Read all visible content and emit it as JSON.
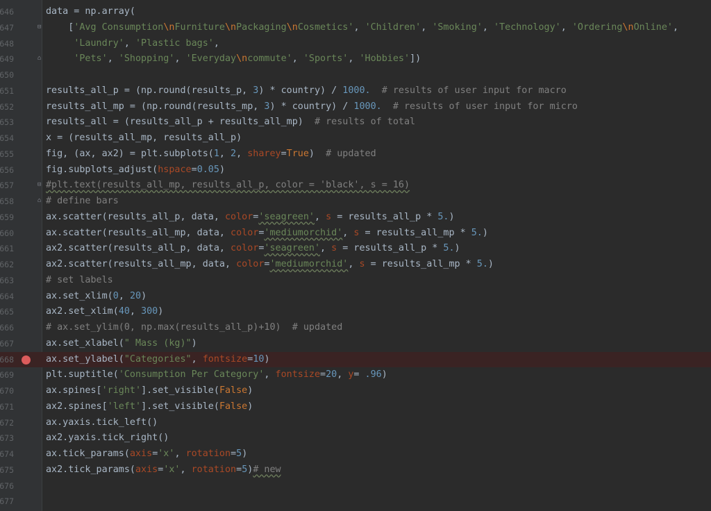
{
  "editor": {
    "lines": [
      {
        "num": "646",
        "fold": "",
        "bp": false,
        "tokens": [
          [
            "data = np.array(",
            "p"
          ]
        ]
      },
      {
        "num": "647",
        "fold": "−",
        "bp": false,
        "tokens": [
          [
            "    [",
            "p"
          ],
          [
            "'Avg Consumption",
            "str"
          ],
          [
            "\\n",
            "esc"
          ],
          [
            "Furniture",
            "str"
          ],
          [
            "\\n",
            "esc"
          ],
          [
            "Packaging",
            "str"
          ],
          [
            "\\n",
            "esc"
          ],
          [
            "Cosmetics'",
            "str"
          ],
          [
            ", ",
            "p"
          ],
          [
            "'Children'",
            "str"
          ],
          [
            ", ",
            "p"
          ],
          [
            "'Smoking'",
            "str"
          ],
          [
            ", ",
            "p"
          ],
          [
            "'Technology'",
            "str"
          ],
          [
            ", ",
            "p"
          ],
          [
            "'Ordering",
            "str"
          ],
          [
            "\\n",
            "esc"
          ],
          [
            "Online'",
            "str"
          ],
          [
            ",",
            "p"
          ]
        ]
      },
      {
        "num": "648",
        "fold": "",
        "bp": false,
        "tokens": [
          [
            "     ",
            "p"
          ],
          [
            "'Laundry'",
            "str"
          ],
          [
            ", ",
            "p"
          ],
          [
            "'Plastic bags'",
            "str"
          ],
          [
            ",",
            "p"
          ]
        ]
      },
      {
        "num": "649",
        "fold": "△",
        "bp": false,
        "tokens": [
          [
            "     ",
            "p"
          ],
          [
            "'Pets'",
            "str"
          ],
          [
            ", ",
            "p"
          ],
          [
            "'Shopping'",
            "str"
          ],
          [
            ", ",
            "p"
          ],
          [
            "'Everyday",
            "str"
          ],
          [
            "\\n",
            "esc"
          ],
          [
            "commute'",
            "str"
          ],
          [
            ", ",
            "p"
          ],
          [
            "'Sports'",
            "str"
          ],
          [
            ", ",
            "p"
          ],
          [
            "'Hobbies'",
            "str"
          ],
          [
            "])",
            "p"
          ]
        ]
      },
      {
        "num": "650",
        "fold": "",
        "bp": false,
        "tokens": []
      },
      {
        "num": "651",
        "fold": "",
        "bp": false,
        "tokens": [
          [
            "results_all_p = (np.round(results_p, ",
            "p"
          ],
          [
            "3",
            "num"
          ],
          [
            ") * country) / ",
            "p"
          ],
          [
            "1000.",
            "num"
          ],
          [
            "  ",
            "p"
          ],
          [
            "# results of user input for macro",
            "cm"
          ]
        ]
      },
      {
        "num": "652",
        "fold": "",
        "bp": false,
        "tokens": [
          [
            "results_all_mp = (np.round(results_mp, ",
            "p"
          ],
          [
            "3",
            "num"
          ],
          [
            ") * country) / ",
            "p"
          ],
          [
            "1000.",
            "num"
          ],
          [
            "  ",
            "p"
          ],
          [
            "# results of user input for micro",
            "cm"
          ]
        ]
      },
      {
        "num": "653",
        "fold": "",
        "bp": false,
        "tokens": [
          [
            "results_all = (results_all_p + results_all_mp)  ",
            "p"
          ],
          [
            "# results of total",
            "cm"
          ]
        ]
      },
      {
        "num": "654",
        "fold": "",
        "bp": false,
        "tokens": [
          [
            "x = (results_all_mp, results_all_p)",
            "p"
          ]
        ]
      },
      {
        "num": "655",
        "fold": "",
        "bp": false,
        "tokens": [
          [
            "fig, (ax, ax2) = plt.subplots(",
            "p"
          ],
          [
            "1",
            "num"
          ],
          [
            ", ",
            "p"
          ],
          [
            "2",
            "num"
          ],
          [
            ", ",
            "p"
          ],
          [
            "sharey",
            "kwarg"
          ],
          [
            "=",
            "p"
          ],
          [
            "True",
            "kw"
          ],
          [
            ")  ",
            "p"
          ],
          [
            "# updated",
            "cm"
          ]
        ]
      },
      {
        "num": "656",
        "fold": "",
        "bp": false,
        "tokens": [
          [
            "fig.subplots_adjust(",
            "p"
          ],
          [
            "hspace",
            "kwarg"
          ],
          [
            "=",
            "p"
          ],
          [
            "0.05",
            "num"
          ],
          [
            ")",
            "p"
          ]
        ]
      },
      {
        "num": "657",
        "fold": "−",
        "bp": false,
        "tokens": [
          [
            "#plt.text(results_all_mp, results_all_p, color = 'black', s = 16)",
            "cm wavy"
          ]
        ]
      },
      {
        "num": "658",
        "fold": "△",
        "bp": false,
        "tokens": [
          [
            "# define bars",
            "cm"
          ]
        ]
      },
      {
        "num": "659",
        "fold": "",
        "bp": false,
        "tokens": [
          [
            "ax.scatter(results_all_p, data, ",
            "p"
          ],
          [
            "color",
            "kwarg"
          ],
          [
            "=",
            "p"
          ],
          [
            "'seagreen'",
            "str wavy"
          ],
          [
            ", ",
            "p"
          ],
          [
            "s",
            "kwarg"
          ],
          [
            " = results_all_p * ",
            "p"
          ],
          [
            "5.",
            "num"
          ],
          [
            ")",
            "p"
          ]
        ]
      },
      {
        "num": "660",
        "fold": "",
        "bp": false,
        "tokens": [
          [
            "ax.scatter(results_all_mp, data, ",
            "p"
          ],
          [
            "color",
            "kwarg"
          ],
          [
            "=",
            "p"
          ],
          [
            "'mediumorchid'",
            "str wavy"
          ],
          [
            ", ",
            "p"
          ],
          [
            "s",
            "kwarg"
          ],
          [
            " = results_all_mp * ",
            "p"
          ],
          [
            "5.",
            "num"
          ],
          [
            ")",
            "p"
          ]
        ]
      },
      {
        "num": "661",
        "fold": "",
        "bp": false,
        "tokens": [
          [
            "ax2.scatter(results_all_p, data, ",
            "p"
          ],
          [
            "color",
            "kwarg"
          ],
          [
            "=",
            "p"
          ],
          [
            "'seagreen'",
            "str wavy"
          ],
          [
            ", ",
            "p"
          ],
          [
            "s",
            "kwarg"
          ],
          [
            " = results_all_p * ",
            "p"
          ],
          [
            "5.",
            "num"
          ],
          [
            ")",
            "p"
          ]
        ]
      },
      {
        "num": "662",
        "fold": "",
        "bp": false,
        "tokens": [
          [
            "ax2.scatter(results_all_mp, data, ",
            "p"
          ],
          [
            "color",
            "kwarg"
          ],
          [
            "=",
            "p"
          ],
          [
            "'mediumorchid'",
            "str wavy"
          ],
          [
            ", ",
            "p"
          ],
          [
            "s",
            "kwarg"
          ],
          [
            " = results_all_mp * ",
            "p"
          ],
          [
            "5.",
            "num"
          ],
          [
            ")",
            "p"
          ]
        ]
      },
      {
        "num": "663",
        "fold": "",
        "bp": false,
        "tokens": [
          [
            "# set labels",
            "cm"
          ]
        ]
      },
      {
        "num": "664",
        "fold": "",
        "bp": false,
        "tokens": [
          [
            "ax.set_xlim(",
            "p"
          ],
          [
            "0",
            "num"
          ],
          [
            ", ",
            "p"
          ],
          [
            "20",
            "num"
          ],
          [
            ")",
            "p"
          ]
        ]
      },
      {
        "num": "665",
        "fold": "",
        "bp": false,
        "tokens": [
          [
            "ax2.set_xlim(",
            "p"
          ],
          [
            "40",
            "num"
          ],
          [
            ", ",
            "p"
          ],
          [
            "300",
            "num"
          ],
          [
            ")",
            "p"
          ]
        ]
      },
      {
        "num": "666",
        "fold": "",
        "bp": false,
        "tokens": [
          [
            "# ax.set_ylim(0, np.max(results_all_p)+10)  # updated",
            "cm"
          ]
        ]
      },
      {
        "num": "667",
        "fold": "",
        "bp": false,
        "tokens": [
          [
            "ax.set_xlabel(",
            "p"
          ],
          [
            "\" Mass (kg)\"",
            "str"
          ],
          [
            ")",
            "p"
          ]
        ]
      },
      {
        "num": "668",
        "fold": "",
        "bp": true,
        "tokens": [
          [
            "ax.set_ylabel(",
            "p"
          ],
          [
            "\"Categories\"",
            "str"
          ],
          [
            ", ",
            "p"
          ],
          [
            "fontsize",
            "kwarg"
          ],
          [
            "=",
            "p"
          ],
          [
            "10",
            "num"
          ],
          [
            ")",
            "p"
          ]
        ]
      },
      {
        "num": "669",
        "fold": "",
        "bp": false,
        "tokens": [
          [
            "plt.suptitle(",
            "p"
          ],
          [
            "'Consumption Per Category'",
            "str"
          ],
          [
            ", ",
            "p"
          ],
          [
            "fontsize",
            "kwarg"
          ],
          [
            "=",
            "p"
          ],
          [
            "20",
            "num"
          ],
          [
            ", ",
            "p"
          ],
          [
            "y",
            "kwarg"
          ],
          [
            "= ",
            "p"
          ],
          [
            ".96",
            "num"
          ],
          [
            ")",
            "p"
          ]
        ]
      },
      {
        "num": "670",
        "fold": "",
        "bp": false,
        "tokens": [
          [
            "ax.spines[",
            "p"
          ],
          [
            "'right'",
            "str"
          ],
          [
            "].set_visible(",
            "p"
          ],
          [
            "False",
            "kw"
          ],
          [
            ")",
            "p"
          ]
        ]
      },
      {
        "num": "671",
        "fold": "",
        "bp": false,
        "tokens": [
          [
            "ax2.spines[",
            "p"
          ],
          [
            "'left'",
            "str"
          ],
          [
            "].set_visible(",
            "p"
          ],
          [
            "False",
            "kw"
          ],
          [
            ")",
            "p"
          ]
        ]
      },
      {
        "num": "672",
        "fold": "",
        "bp": false,
        "tokens": [
          [
            "ax.yaxis.tick_left()",
            "p"
          ]
        ]
      },
      {
        "num": "673",
        "fold": "",
        "bp": false,
        "tokens": [
          [
            "ax2.yaxis.tick_right()",
            "p"
          ]
        ]
      },
      {
        "num": "674",
        "fold": "",
        "bp": false,
        "tokens": [
          [
            "ax.tick_params(",
            "p"
          ],
          [
            "axis",
            "kwarg"
          ],
          [
            "=",
            "p"
          ],
          [
            "'x'",
            "str"
          ],
          [
            ", ",
            "p"
          ],
          [
            "rotation",
            "kwarg"
          ],
          [
            "=",
            "p"
          ],
          [
            "5",
            "num"
          ],
          [
            ")",
            "p"
          ]
        ]
      },
      {
        "num": "675",
        "fold": "",
        "bp": false,
        "tokens": [
          [
            "ax2.tick_params(",
            "p"
          ],
          [
            "axis",
            "kwarg"
          ],
          [
            "=",
            "p"
          ],
          [
            "'x'",
            "str"
          ],
          [
            ", ",
            "p"
          ],
          [
            "rotation",
            "kwarg"
          ],
          [
            "=",
            "p"
          ],
          [
            "5",
            "num"
          ],
          [
            ")",
            "p"
          ],
          [
            "# new",
            "cm wavy"
          ]
        ]
      },
      {
        "num": "676",
        "fold": "",
        "bp": false,
        "tokens": []
      },
      {
        "num": "677",
        "fold": "",
        "bp": false,
        "tokens": []
      }
    ]
  }
}
